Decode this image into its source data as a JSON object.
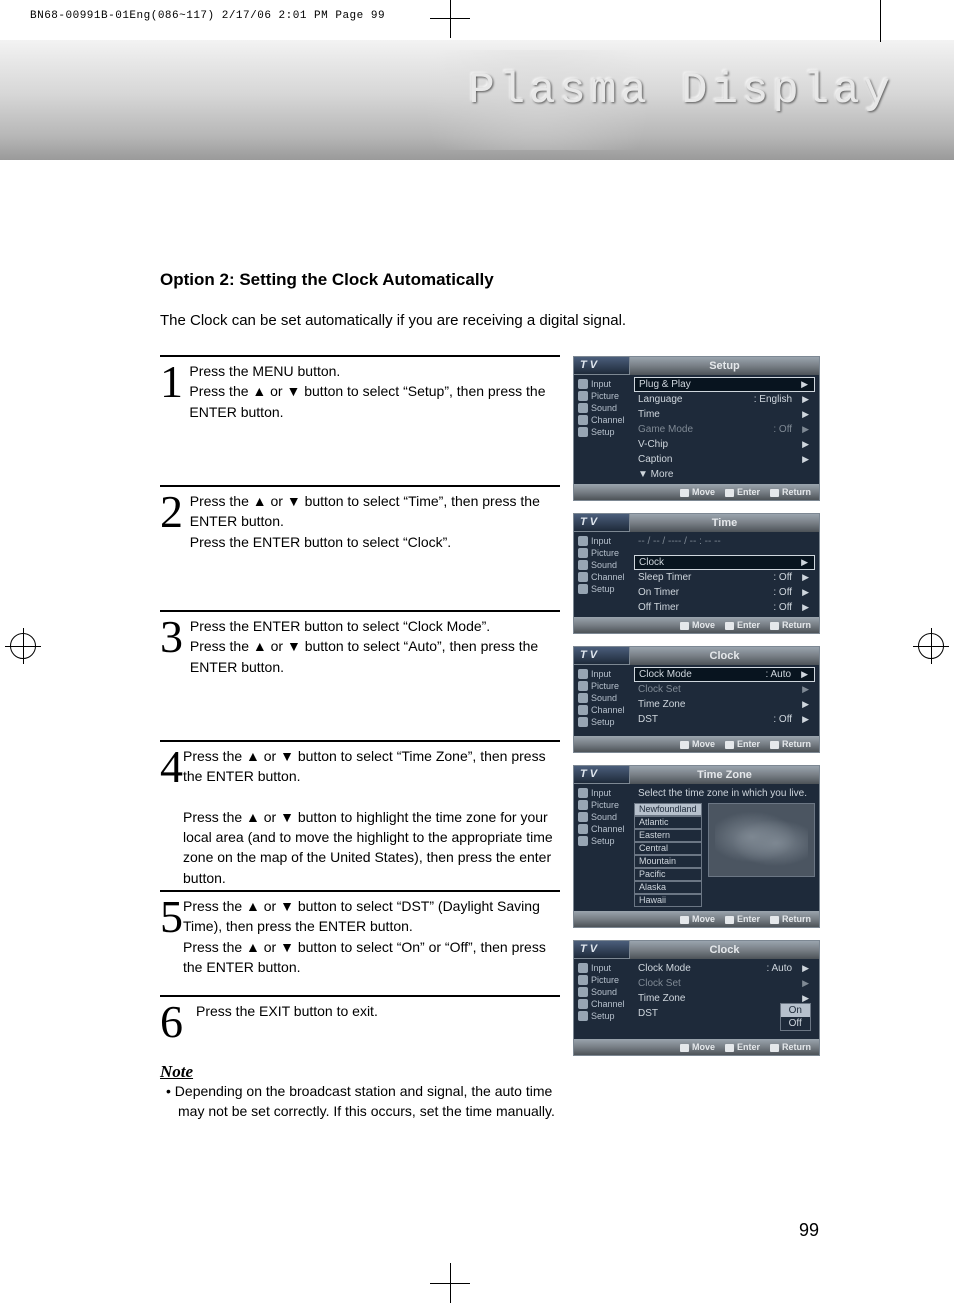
{
  "print_header": "BN68-00991B-01Eng(086~117)  2/17/06  2:01 PM  Page 99",
  "banner_title": "Plasma Display",
  "section_title": "Option 2: Setting the Clock Automatically",
  "intro": "The Clock can be set automatically if you are receiving a digital signal.",
  "steps": [
    {
      "num": "1",
      "text": "Press the MENU button.\nPress the ▲ or ▼ button to select “Setup”, then press the ENTER button."
    },
    {
      "num": "2",
      "text": "Press the ▲ or ▼ button to select “Time”, then press the ENTER button.\nPress the ENTER button to select “Clock”."
    },
    {
      "num": "3",
      "text": "Press the ENTER button to select “Clock Mode”.\nPress the ▲ or ▼ button to select “Auto”, then press the ENTER button."
    },
    {
      "num": "4",
      "text": "Press the ▲ or ▼ button to select “Time Zone”, then press the ENTER button.\n\nPress the ▲ or ▼ button to highlight the time zone for your local area (and to move the highlight to the appropriate time zone on the map of the United States), then press the enter button."
    },
    {
      "num": "5",
      "text": "Press the ▲ or ▼ button to select “DST” (Daylight Saving Time), then press the ENTER button.\nPress the ▲ or ▼ button to select “On” or “Off”, then press the ENTER button."
    },
    {
      "num": "6",
      "text": "Press the EXIT button to exit."
    }
  ],
  "note_heading": "Note",
  "note_body": "Depending on the broadcast station and signal, the auto time may not be set correctly. If this occurs, set the time manually.",
  "page_number": "99",
  "osd_common": {
    "tv": "T V",
    "sidebar": [
      "Input",
      "Picture",
      "Sound",
      "Channel",
      "Setup"
    ],
    "footer": {
      "move": "Move",
      "enter": "Enter",
      "return": "Return"
    }
  },
  "osds": [
    {
      "title": "Setup",
      "rows": [
        {
          "label": "Plug & Play",
          "val": "",
          "sel": true
        },
        {
          "label": "Language",
          "val": ": English"
        },
        {
          "label": "Time",
          "val": ""
        },
        {
          "label": "Game Mode",
          "val": ": Off",
          "dim": true
        },
        {
          "label": "V-Chip",
          "val": ""
        },
        {
          "label": "Caption",
          "val": ""
        },
        {
          "label": "▼ More",
          "val": "",
          "noarrow": true
        }
      ]
    },
    {
      "title": "Time",
      "pre": "  -- / -- / ----  /  -- : --  --",
      "rows": [
        {
          "label": "Clock",
          "val": "",
          "sel": true
        },
        {
          "label": "Sleep Timer",
          "val": ": Off"
        },
        {
          "label": "On Timer",
          "val": ": Off"
        },
        {
          "label": "Off Timer",
          "val": ": Off"
        }
      ]
    },
    {
      "title": "Clock",
      "rows": [
        {
          "label": "Clock Mode",
          "val": ": Auto",
          "sel": true
        },
        {
          "label": "Clock Set",
          "val": "",
          "dim": true
        },
        {
          "label": "Time Zone",
          "val": ""
        },
        {
          "label": "DST",
          "val": ": Off"
        }
      ]
    },
    {
      "title": "Time Zone",
      "tz": true,
      "prompt": "Select the time zone in which you live.",
      "zones": [
        "Newfoundland",
        "Atlantic",
        "Eastern",
        "Central",
        "Mountain",
        "Pacific",
        "Alaska",
        "Hawaii"
      ],
      "zone_sel": "Newfoundland"
    },
    {
      "title": "Clock",
      "dst": true,
      "rows": [
        {
          "label": "Clock Mode",
          "val": ": Auto"
        },
        {
          "label": "Clock Set",
          "val": "",
          "dim": true
        },
        {
          "label": "Time Zone",
          "val": ""
        },
        {
          "label": "DST",
          "val": ":"
        }
      ],
      "dst_options": [
        "On",
        "Off"
      ],
      "dst_sel": "On"
    }
  ]
}
